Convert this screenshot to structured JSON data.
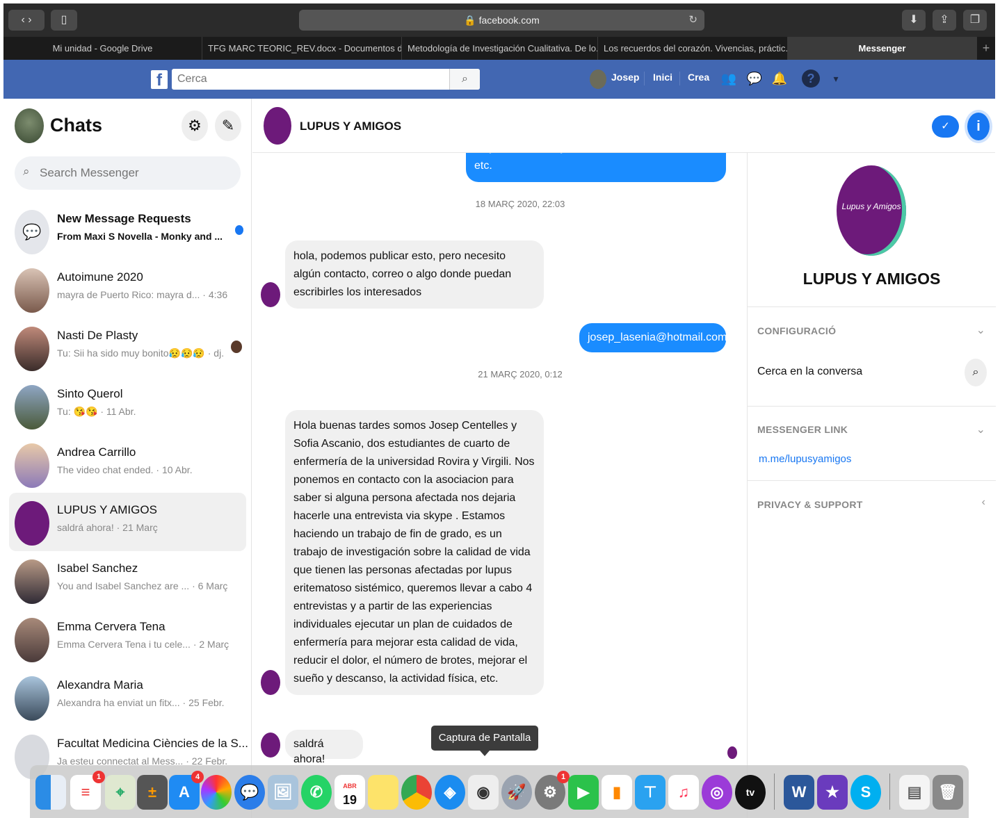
{
  "browser": {
    "url": "facebook.com",
    "tabs": [
      {
        "label": "Mi unidad - Google Drive",
        "active": false
      },
      {
        "label": "TFG MARC TEORIC_REV.docx - Documentos de...",
        "active": false
      },
      {
        "label": "Metodología de Investigación Cualitativa. De lo...",
        "active": false
      },
      {
        "label": "Los recuerdos del corazón. Vivencias, práctic...",
        "active": false
      },
      {
        "label": "Messenger",
        "active": true
      }
    ],
    "new_tab": "+"
  },
  "fb_header": {
    "logo": "f",
    "search_placeholder": "Cerca",
    "user_name": "Josep",
    "nav_home": "Inici",
    "nav_create": "Crea",
    "help": "?",
    "menu": "▾"
  },
  "sidebar": {
    "title": "Chats",
    "search_placeholder": "Search Messenger",
    "chats": [
      {
        "name": "New Message Requests",
        "snippet": "From Maxi S Novella - Monky and ...",
        "bold": true,
        "unread": true
      },
      {
        "name": "Autoimune 2020",
        "snippet": "mayra de Puerto Rico: mayra d... · 4:36"
      },
      {
        "name": "Nasti De Plasty",
        "snippet": "Tu: Sii ha sido muy bonito😥😥😥 · dj."
      },
      {
        "name": "Sinto Querol",
        "snippet": "Tu: 😘😘 · 11 Abr."
      },
      {
        "name": "Andrea Carrillo",
        "snippet": "The video chat ended. · 10 Abr."
      },
      {
        "name": "LUPUS Y AMIGOS",
        "snippet": "saldrá ahora! · 21 Març",
        "active": true
      },
      {
        "name": "Isabel Sanchez",
        "snippet": "You and Isabel Sanchez are ... · 6 Març"
      },
      {
        "name": "Emma Cervera Tena",
        "snippet": "Emma Cervera Tena i tu cele... · 2 Març"
      },
      {
        "name": "Alexandra Maria",
        "snippet": "Alexandra ha enviat un fitx... · 25 Febr."
      },
      {
        "name": "Facultat Medicina Ciències de la S...",
        "snippet": "Ja esteu connectat al Mess... · 22 Febr."
      }
    ]
  },
  "conversation": {
    "name": "LUPUS Y AMIGOS",
    "check_label": "✓",
    "info_label": "i",
    "messages": [
      {
        "type": "out",
        "text": "mejorar el sueño y descanso, la actividad física, etc."
      },
      {
        "type": "timestamp",
        "text": "18 MARÇ 2020, 22:03"
      },
      {
        "type": "in",
        "text": "hola, podemos publicar esto, pero necesito algún contacto, correo o algo donde puedan escribirles los interesados"
      },
      {
        "type": "out",
        "text": "josep_lasenia@hotmail.com"
      },
      {
        "type": "timestamp",
        "text": "21 MARÇ 2020, 0:12"
      },
      {
        "type": "in",
        "text": "Hola buenas tardes somos Josep Centelles y Sofia Ascanio, dos estudiantes de cuarto de enfermería de la universidad Rovira y Virgili. Nos ponemos en contacto con la asociacion para saber si alguna persona afectada nos dejaria hacerle una entrevista via skype . Estamos haciendo un trabajo de fin de grado, es un trabajo de investigación sobre la calidad de vida que tienen las personas afectadas por lupus eritematoso sistémico, queremos llevar a cabo 4 entrevistas y a partir de las experiencias individuales ejecutar un plan de cuidados de enfermería para mejorar esta calidad de vida, reducir el dolor, el número de brotes, mejorar el sueño y descanso, la actividad física, etc."
      },
      {
        "type": "in",
        "text": "saldrá ahora!"
      }
    ],
    "tooltip": "Captura de Pantalla"
  },
  "info_panel": {
    "name": "LUPUS Y AMIGOS",
    "avatar_text": "Lupus y Amigos",
    "config_title": "CONFIGURACIÓ",
    "search_label": "Cerca en la conversa",
    "link_title": "MESSENGER LINK",
    "link": "m.me/lupusyamigos",
    "privacy_title": "PRIVACY & SUPPORT"
  },
  "dock": {
    "calendar_day": "19",
    "calendar_month": "ABR",
    "badges": {
      "reminders": "1",
      "appstore": "4",
      "settings": "1"
    }
  },
  "colors": {
    "fb_blue": "#4267b2",
    "messenger_blue": "#1a8cff",
    "lupus_purple": "#6d1a7a"
  }
}
